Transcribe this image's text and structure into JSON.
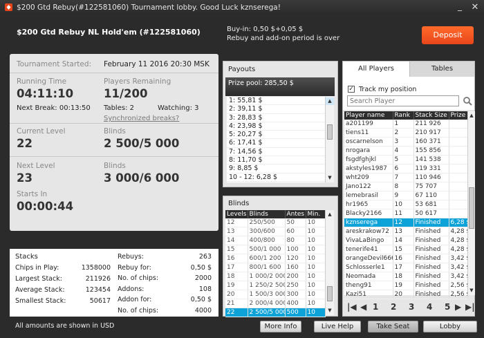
{
  "window": {
    "title": "$200 Gtd Rebuy(#122581060) Tournament lobby. Good Luck kznserega!",
    "minimize": "_",
    "close": "✕"
  },
  "header": {
    "name": "$200 Gtd Rebuy NL Hold'em (#122581060)",
    "buyin_line": "Buy-in: 0,50 $+0,05 $",
    "rebuy_line": "Rebuy and add-on period is over",
    "deposit": "Deposit"
  },
  "info": {
    "started_label": "Tournament Started:",
    "started_value": "February 11 2016  20:30 MSK",
    "running_label": "Running Time",
    "running_value": "04:11:10",
    "remaining_label": "Players Remaining",
    "remaining_value": "11/200",
    "next_break": "Next Break: 00:13:50",
    "tables": "Tables: 2",
    "watching": "Watching: 3",
    "sync_breaks": "Synchronized breaks?",
    "current_level_label": "Current Level",
    "current_level": "22",
    "blinds_label": "Blinds",
    "current_blinds": "2 500/5 000",
    "next_level_label": "Next Level",
    "next_level": "23",
    "next_blinds_label": "Blinds",
    "next_blinds": "3 000/6 000",
    "starts_in_label": "Starts In",
    "starts_in": "00:00:44"
  },
  "stacks": {
    "title": "Stacks",
    "left": [
      [
        "Chips in Play:",
        "1358000"
      ],
      [
        "Largest Stack:",
        "211926"
      ],
      [
        "Average Stack:",
        "123454"
      ],
      [
        "Smallest Stack:",
        "50617"
      ]
    ],
    "right": [
      [
        "Rebuys:",
        "263"
      ],
      [
        "Rebuy for:",
        "0,50 $"
      ],
      [
        "No. of chips:",
        "2000"
      ],
      [
        "Addons:",
        "108"
      ],
      [
        "Addon for:",
        "0,50 $"
      ],
      [
        "No. of chips:",
        "4000"
      ]
    ]
  },
  "payouts": {
    "title": "Payouts",
    "prize_pool": "Prize pool: 285,50 $",
    "items": [
      "1: 55,81 $",
      "2: 39,11 $",
      "3: 28,83 $",
      "4: 23,98 $",
      "5: 20,27 $",
      "6: 17,41 $",
      "7: 14,56 $",
      "8: 11,70 $",
      "9: 8,85 $",
      "10 - 12: 6,28 $"
    ]
  },
  "blinds": {
    "title": "Blinds",
    "headers": [
      "Levels",
      "Blinds",
      "Antes",
      "Min."
    ],
    "rows": [
      [
        "12",
        "250/500",
        "50",
        "10"
      ],
      [
        "13",
        "300/600",
        "60",
        "10"
      ],
      [
        "14",
        "400/800",
        "80",
        "10"
      ],
      [
        "15",
        "500/1 000",
        "100",
        "10"
      ],
      [
        "16",
        "600/1 200",
        "120",
        "10"
      ],
      [
        "17",
        "800/1 600",
        "160",
        "10"
      ],
      [
        "18",
        "1 000/2 000",
        "200",
        "10"
      ],
      [
        "19",
        "1 250/2 500",
        "250",
        "10"
      ],
      [
        "20",
        "1 500/3 000",
        "300",
        "10"
      ],
      [
        "21",
        "2 000/4 000",
        "400",
        "10"
      ],
      [
        "22",
        "2 500/5 000",
        "500",
        "10"
      ]
    ],
    "selected_index": 10
  },
  "players": {
    "tab_all": "All Players",
    "tab_tables": "Tables",
    "track_label": "Track my position",
    "search_placeholder": "Search Player",
    "headers": [
      "Player name",
      "Rank",
      "Stack Size",
      "Prize"
    ],
    "rows": [
      [
        "a201199",
        "1",
        "211 926",
        ""
      ],
      [
        "tiens11",
        "2",
        "210 917",
        ""
      ],
      [
        "oscarnelson",
        "3",
        "160 371",
        ""
      ],
      [
        "nrogara",
        "4",
        "155 856",
        ""
      ],
      [
        "fsgdfghjkl",
        "5",
        "141 538",
        ""
      ],
      [
        "akstyles1987",
        "6",
        "119 331",
        ""
      ],
      [
        "wht209",
        "7",
        "110 946",
        ""
      ],
      [
        "Jano122",
        "8",
        "75 707",
        ""
      ],
      [
        "lemebrasil",
        "9",
        "67 110",
        ""
      ],
      [
        "hr1965",
        "10",
        "53 681",
        ""
      ],
      [
        "Blacky2166",
        "11",
        "50 617",
        ""
      ],
      [
        "kznserega",
        "12",
        "Finished",
        "6,28 $"
      ],
      [
        "areskrakow72",
        "13",
        "Finished",
        "4,28 $"
      ],
      [
        "VivaLaBingo",
        "14",
        "Finished",
        "4,28 $"
      ],
      [
        "tenerife41",
        "15",
        "Finished",
        "4,28 $"
      ],
      [
        "orangeDevil666",
        "16",
        "Finished",
        "3,42 $"
      ],
      [
        "Schlosserle1",
        "17",
        "Finished",
        "3,42 $"
      ],
      [
        "Neomada",
        "18",
        "Finished",
        "3,42 $"
      ],
      [
        "theng91",
        "19",
        "Finished",
        "2,56 $"
      ],
      [
        "Kazi51",
        "20",
        "Finished",
        "2,56 $"
      ]
    ],
    "selected_index": 11,
    "pages": [
      "1",
      "2",
      "3",
      "4",
      "5"
    ]
  },
  "footer": {
    "note": "All amounts are shown in USD",
    "more_info": "More Info",
    "live_help": "Live Help",
    "take_seat": "Take Seat",
    "lobby": "Lobby"
  }
}
